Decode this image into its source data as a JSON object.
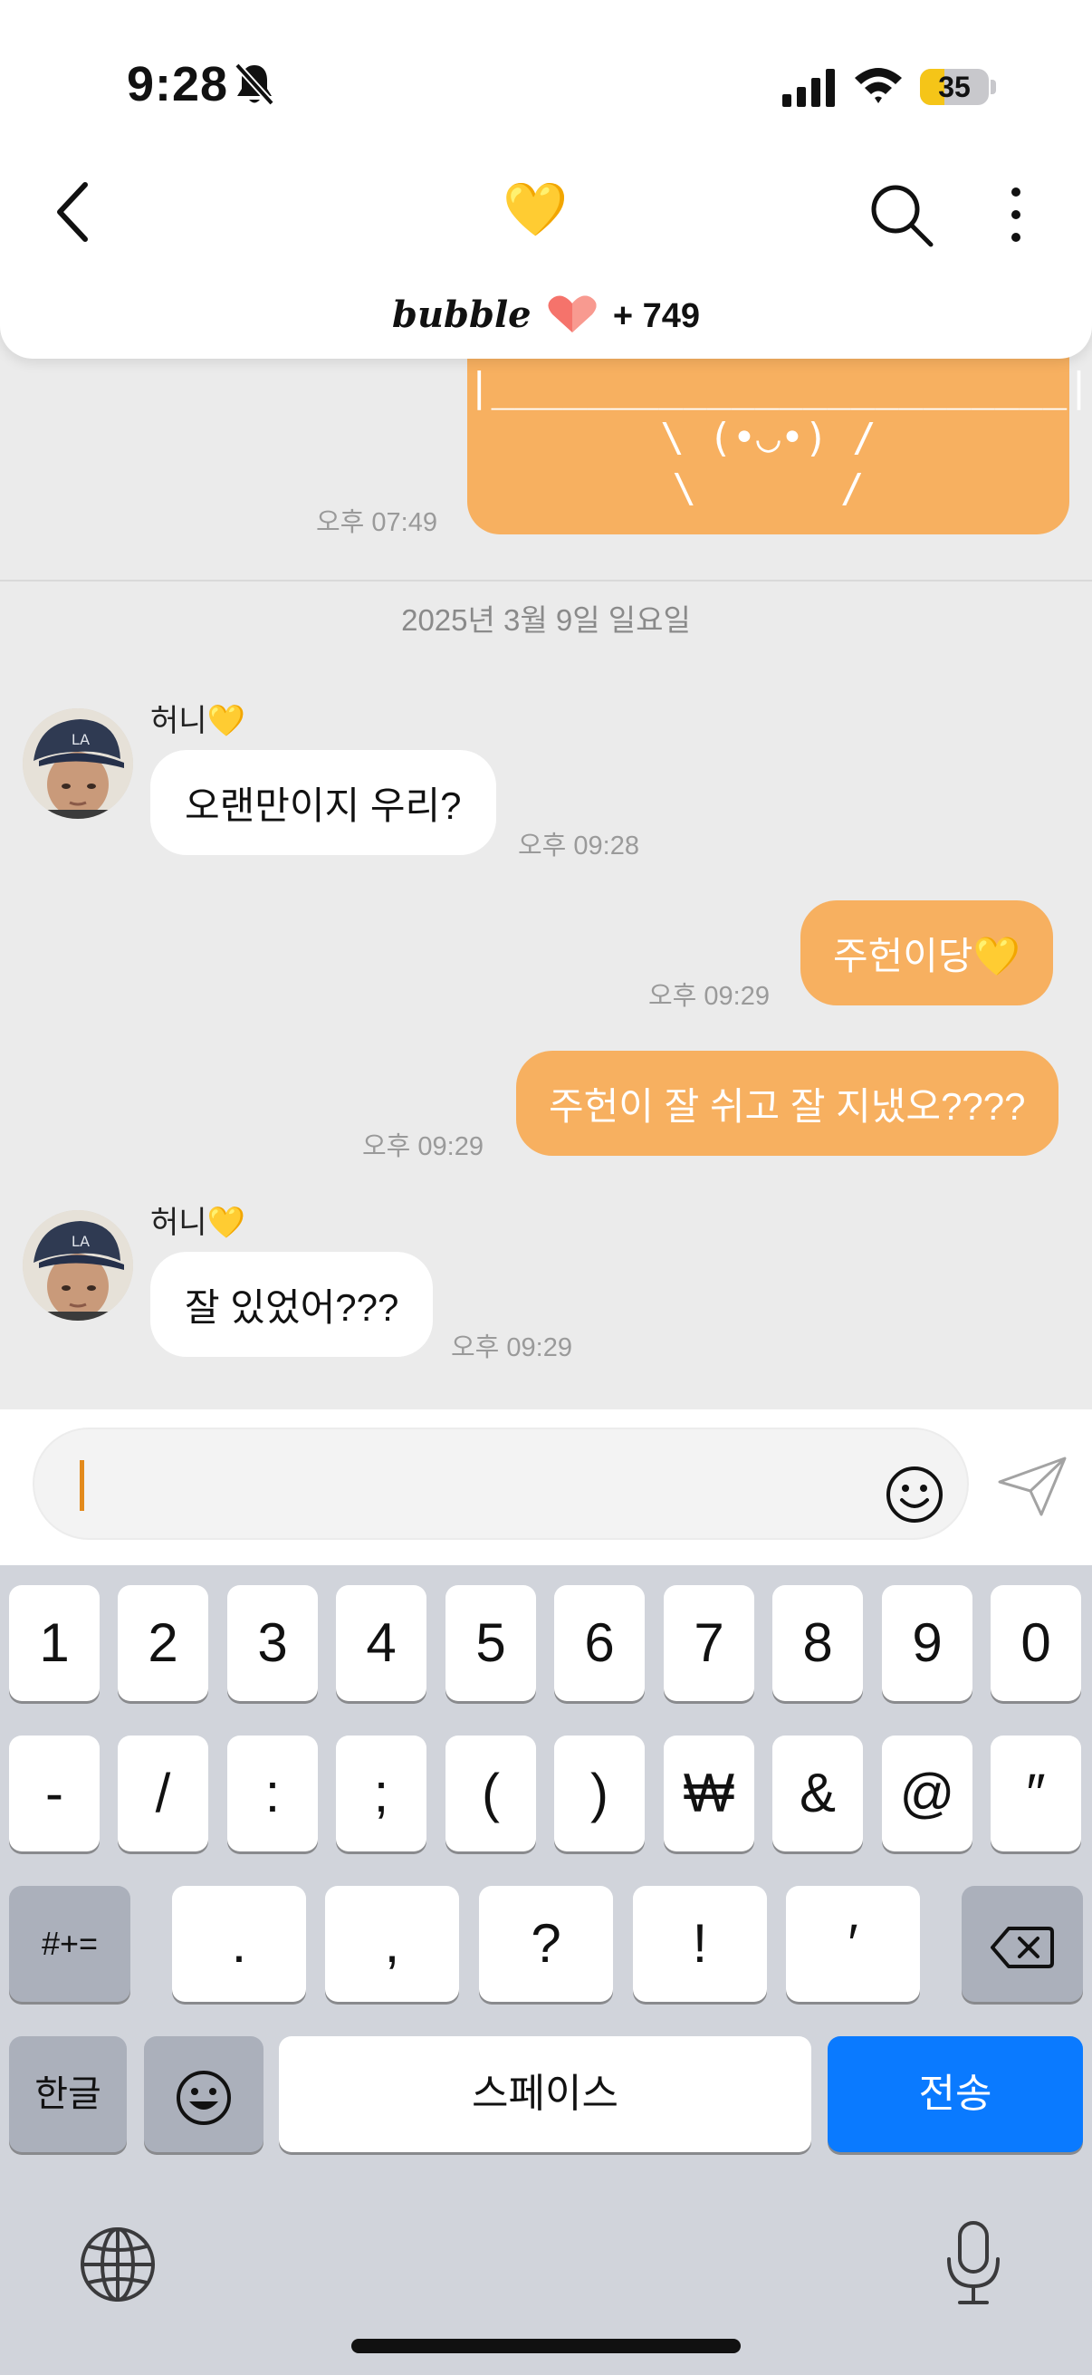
{
  "status_bar": {
    "time": "9:28",
    "battery": "35",
    "battery_level_percent": 35,
    "icons": [
      "bell-slash-icon",
      "cellular-signal-icon",
      "wifi-icon",
      "battery-icon"
    ]
  },
  "header": {
    "title_emoji": "💛",
    "brand": "bubble",
    "brand_count": "+ 749",
    "icons": [
      "back-chevron-icon",
      "search-icon",
      "more-vertical-icon",
      "heart-icon"
    ]
  },
  "messages": {
    "art_lines": [
      "|________________________|",
      "\\ (•◡•) /",
      "\\      /"
    ],
    "art_time": "오후 07:49",
    "date_divider": "2025년 3월 9일 일요일",
    "msg1": {
      "sender": "허니💛",
      "text": "오랜만이지 우리?",
      "time": "오후 09:28"
    },
    "msg2": {
      "text": "주헌이당💛",
      "time": "오후 09:29"
    },
    "msg3": {
      "text": "주헌이 잘 쉬고 잘 지냈오????",
      "time": "오후 09:29"
    },
    "msg4": {
      "sender": "허니💛",
      "text": "잘 있었어???",
      "time": "오후 09:29"
    }
  },
  "input": {
    "icons": [
      "emoji-icon",
      "send-icon"
    ]
  },
  "keyboard": {
    "row1": [
      "1",
      "2",
      "3",
      "4",
      "5",
      "6",
      "7",
      "8",
      "9",
      "0"
    ],
    "row2": [
      "-",
      "/",
      ":",
      ";",
      "(",
      ")",
      "₩",
      "&",
      "@",
      "″"
    ],
    "row3": [
      "#+=",
      ".",
      ",",
      "?",
      "!",
      "′"
    ],
    "hangul": "한글",
    "space": "스페이스",
    "send": "전송",
    "icons": [
      "delete-icon",
      "emoji-icon",
      "globe-icon",
      "microphone-icon"
    ]
  },
  "colors": {
    "sent_bubble": "#f7b060",
    "received_bubble": "#ffffff",
    "chat_background": "#ebebeb",
    "return_key": "#0a7aff",
    "caret": "#e38a1c"
  }
}
